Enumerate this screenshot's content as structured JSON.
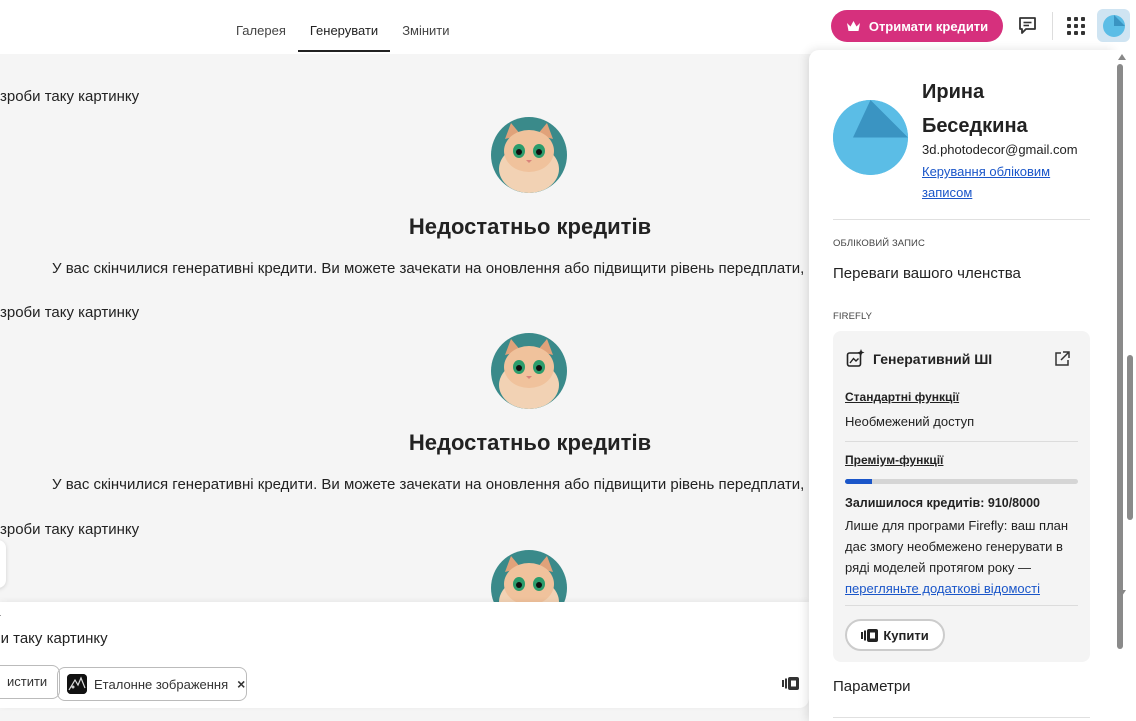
{
  "nav": {
    "tabs": [
      {
        "label": "Галерея",
        "active": false
      },
      {
        "label": "Генерувати",
        "active": true
      },
      {
        "label": "Змінити",
        "active": false
      }
    ]
  },
  "header": {
    "credits_button": "Отримати кредити",
    "credits_button_color": "#d6307d"
  },
  "chat": {
    "prompts": [
      "зроби таку картинку",
      "зроби таку картинку",
      "зроби таку картинку"
    ],
    "no_credits_title": "Недостатньо кредитів",
    "no_credits_text": "У вас скінчилися генеративні кредити. Ви можете зачекати на оновлення або підвищити рівень передплати, що"
  },
  "prompt_box": {
    "label": "т",
    "text": "би таку картинку",
    "clear_button": "истити",
    "reference_chip": "Еталонне зображення",
    "chip_close": "×"
  },
  "account": {
    "name": "Ирина Беседкина",
    "email": "3d.photodecor@gmail.com",
    "manage_link": "Керування обліковим записом",
    "account_section": "ОБЛІКОВИЙ ЗАПИС",
    "membership_link": "Переваги вашого членства",
    "firefly_section": "FIREFLY",
    "card": {
      "title": "Генеративний ШІ",
      "standard_link": "Стандартні функції",
      "standard_value": "Необмежений доступ",
      "premium_link": "Преміум-функції",
      "credits_used_fraction": 0.11375,
      "remaining": "Залишилося кредитів: 910/8000",
      "plan_note": "Лише для програми Firefly: ваш план дає змогу необмежено генерувати в ряді моделей протягом року —",
      "plan_link": "перегляньте додаткові відомості",
      "buy_button": "Купити"
    },
    "settings_link": "Параметри",
    "link_color": "#1a56c9"
  },
  "icons": {
    "credits": "crown-icon",
    "chat": "chat-bubble-icon",
    "apps": "app-grid-icon",
    "generative": "sparkle-image-icon",
    "external": "external-link-icon",
    "buy": "credits-icon"
  }
}
